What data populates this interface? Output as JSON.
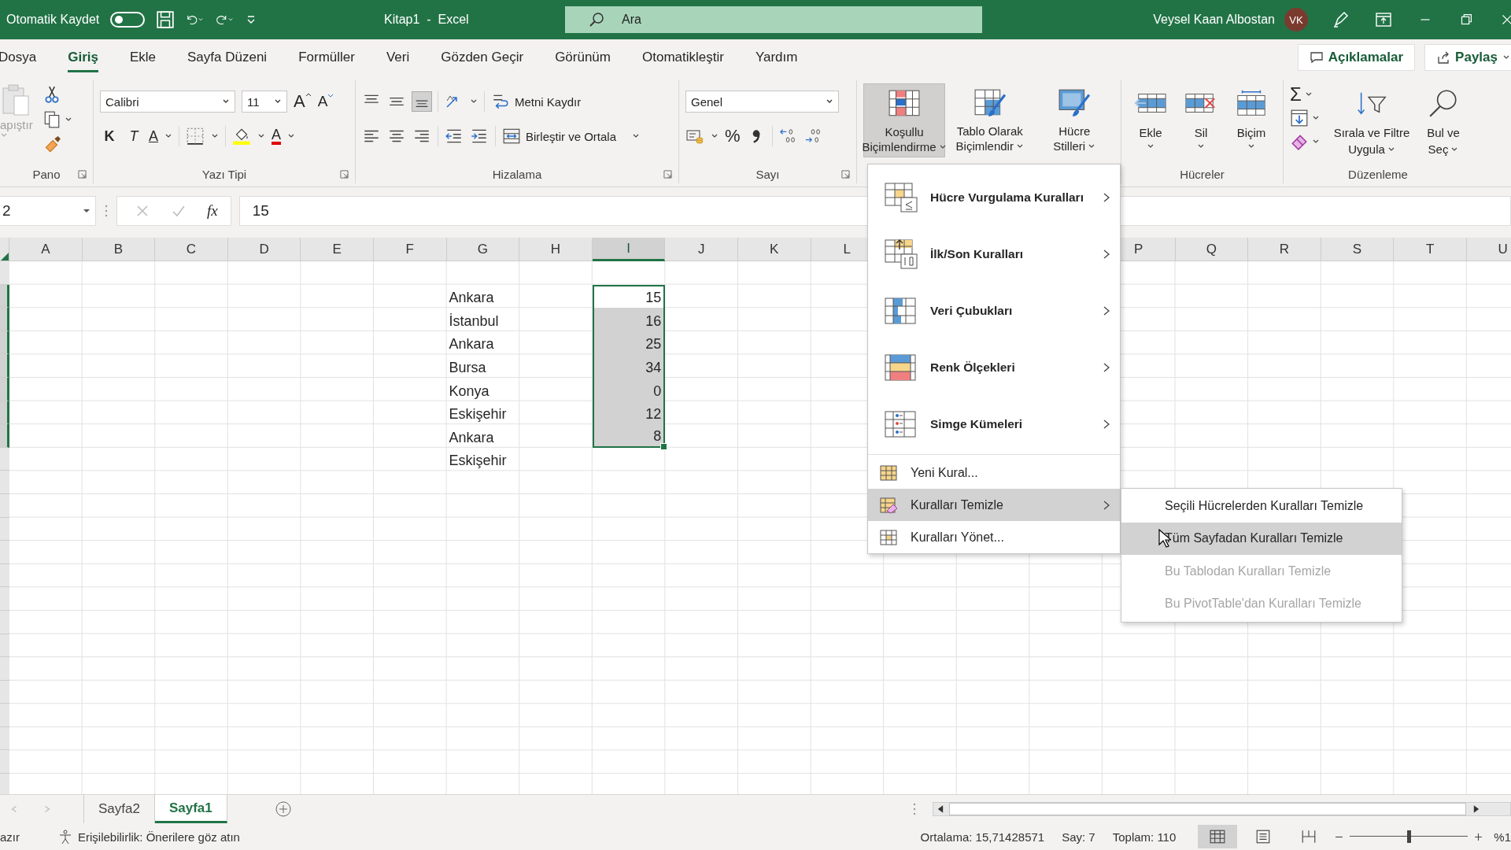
{
  "title_bar": {
    "autosave_label": "Otomatik Kaydet",
    "autosave_on": false,
    "document_title": "Kitap1  -  Excel",
    "search_placeholder": "Ara",
    "user_name": "Veysel Kaan Albostan",
    "user_initials": "VK"
  },
  "ribbon_tabs": [
    {
      "label": "Dosya",
      "selected": false
    },
    {
      "label": "Giriş",
      "selected": true
    },
    {
      "label": "Ekle",
      "selected": false
    },
    {
      "label": "Sayfa Düzeni",
      "selected": false
    },
    {
      "label": "Formüller",
      "selected": false
    },
    {
      "label": "Veri",
      "selected": false
    },
    {
      "label": "Gözden Geçir",
      "selected": false
    },
    {
      "label": "Görünüm",
      "selected": false
    },
    {
      "label": "Otomatikleştir",
      "selected": false
    },
    {
      "label": "Yardım",
      "selected": false
    }
  ],
  "ribbon_actions": {
    "comments": "Açıklamalar",
    "share": "Paylaş"
  },
  "ribbon": {
    "clipboard": {
      "paste": "apıştır",
      "paste_disabled": true,
      "group": "Pano"
    },
    "font": {
      "font_name": "Calibri",
      "font_size": "11",
      "grow": "A",
      "shrink": "A",
      "bold": "K",
      "italic": "T",
      "underline": "A",
      "font_color": "A",
      "group": "Yazı Tipi"
    },
    "alignment": {
      "bottom_align_selected": true,
      "wrap_text": "Metni Kaydır",
      "merge_center": "Birleştir ve Ortala",
      "group": "Hizalama"
    },
    "number": {
      "format": "Genel",
      "percent": "%",
      "group": "Sayı"
    },
    "styles": {
      "conditional": [
        "Koşullu",
        "Biçimlendirme"
      ],
      "conditional_selected": true,
      "table": [
        "Tablo Olarak",
        "Biçimlendir"
      ],
      "cell_styles": [
        "Hücre",
        "Stilleri"
      ]
    },
    "cells": {
      "insert": "Ekle",
      "delete": "Sil",
      "format": "Biçim",
      "group": "Hücreler"
    },
    "editing": {
      "autosum": "Σ",
      "sort_filter": [
        "Sırala ve Filtre",
        "Uygula"
      ],
      "find": [
        "Bul ve",
        "Seç"
      ],
      "group": "Düzenleme"
    }
  },
  "formula_bar": {
    "name_box": "2",
    "function_label": "fx",
    "value": "15"
  },
  "sheet": {
    "columns_left": [
      {
        "label": "A",
        "selected": false
      },
      {
        "label": "B",
        "selected": false
      },
      {
        "label": "C",
        "selected": false
      },
      {
        "label": "D",
        "selected": false
      },
      {
        "label": "E",
        "selected": false
      },
      {
        "label": "F",
        "selected": false
      },
      {
        "label": "G",
        "selected": false
      },
      {
        "label": "H",
        "selected": false
      },
      {
        "label": "I",
        "selected": true
      },
      {
        "label": "J",
        "selected": false
      },
      {
        "label": "K",
        "selected": false
      },
      {
        "label": "L",
        "selected": false
      }
    ],
    "columns_right": [
      {
        "label": "P",
        "selected": false
      },
      {
        "label": "Q",
        "selected": false
      },
      {
        "label": "R",
        "selected": false
      },
      {
        "label": "S",
        "selected": false
      },
      {
        "label": "T",
        "selected": false
      },
      {
        "label": "U",
        "selected": false
      }
    ],
    "rows": [
      {
        "city": "Ankara",
        "value": "15",
        "selected": true
      },
      {
        "city": "İstanbul",
        "value": "16",
        "selected": true
      },
      {
        "city": "Ankara",
        "value": "25",
        "selected": true
      },
      {
        "city": "Bursa",
        "value": "34",
        "selected": true
      },
      {
        "city": "Konya",
        "value": "0",
        "selected": true
      },
      {
        "city": "Eskişehir",
        "value": "12",
        "selected": true
      },
      {
        "city": "Ankara",
        "value": "8",
        "selected": true
      },
      {
        "city": "Eskişehir"
      }
    ]
  },
  "menu": {
    "items": [
      {
        "kind": "large",
        "label": "Hücre Vurgulama Kuralları",
        "highlighted": false
      },
      {
        "kind": "large",
        "label": "İlk/Son Kuralları",
        "highlighted": false
      },
      {
        "kind": "large",
        "label": "Veri Çubukları",
        "highlighted": false
      },
      {
        "kind": "large",
        "label": "Renk Ölçekleri",
        "highlighted": false
      },
      {
        "kind": "large",
        "label": "Simge Kümeleri",
        "highlighted": false
      },
      {
        "kind": "small",
        "label": "Yeni Kural...",
        "highlighted": false,
        "has_submenu": false
      },
      {
        "kind": "small",
        "label": "Kuralları Temizle",
        "highlighted": true,
        "has_submenu": true
      },
      {
        "kind": "small",
        "label": "Kuralları Yönet...",
        "highlighted": false,
        "has_submenu": false
      }
    ],
    "submenu": [
      {
        "label": "Seçili Hücrelerden Kuralları Temizle",
        "highlighted": false,
        "disabled": false
      },
      {
        "label": "Tüm Sayfadan Kuralları Temizle",
        "highlighted": true,
        "disabled": false
      },
      {
        "label": "Bu Tablodan Kuralları Temizle",
        "highlighted": false,
        "disabled": true
      },
      {
        "label": "Bu PivotTable'dan Kuralları Temizle",
        "highlighted": false,
        "disabled": true
      }
    ]
  },
  "sheet_tabs": [
    {
      "label": "Sayfa2",
      "selected": false
    },
    {
      "label": "Sayfa1",
      "selected": true
    }
  ],
  "status_bar": {
    "mode": "azır",
    "accessibility": "Erişilebilirlik: Önerilere göz atın",
    "average": "Ortalama: 15,71428571",
    "count": "Say: 7",
    "sum": "Toplam: 110",
    "views": [
      {
        "selected": true
      },
      {
        "selected": false
      },
      {
        "selected": false
      }
    ],
    "zoom": {
      "level": 0.5,
      "label": "%1"
    }
  }
}
